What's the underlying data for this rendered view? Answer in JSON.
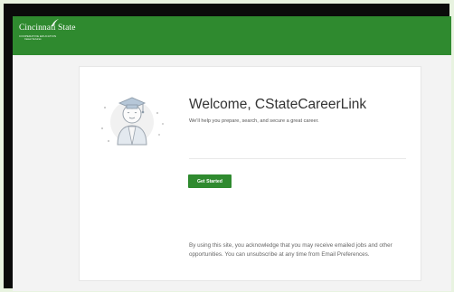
{
  "header": {
    "logo_name": "Cincinnati State",
    "logo_subtitle_1": "COOPERATIVE EDUCATION",
    "logo_subtitle_2": "Career Services",
    "brand_color": "#2f8a2f"
  },
  "welcome": {
    "title": "Welcome, CStateCareerLink",
    "subtitle": "We'll help you prepare, search, and secure a great career.",
    "button_label": "Get Started",
    "illustration_icon": "graduate-icon"
  },
  "disclaimer": "By using this site, you acknowledge that you may receive emailed jobs and other opportunities. You can unsubscribe at any time from Email Preferences."
}
